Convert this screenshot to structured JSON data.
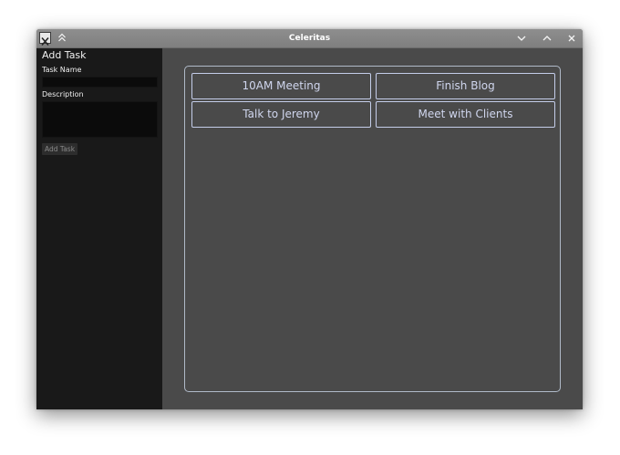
{
  "window": {
    "title": "Celeritas"
  },
  "titlebar_icons": {
    "app": "x-window-icon",
    "keep_above": "keep-above-icon",
    "minimize": "chevron-down-icon",
    "maximize": "chevron-up-icon",
    "close": "close-icon"
  },
  "sidebar": {
    "heading": "Add Task",
    "task_name_label": "Task Name",
    "task_name_value": "",
    "description_label": "Description",
    "description_value": "",
    "add_button_label": "Add Task"
  },
  "tasks": [
    "10AM Meeting",
    "Finish Blog",
    "Talk to Jeremy",
    "Meet with Clients"
  ],
  "colors": {
    "background": "#4a4a4a",
    "sidebar": "#191919",
    "accent_border": "#c4cde9",
    "task_text": "#d0d6ee"
  }
}
